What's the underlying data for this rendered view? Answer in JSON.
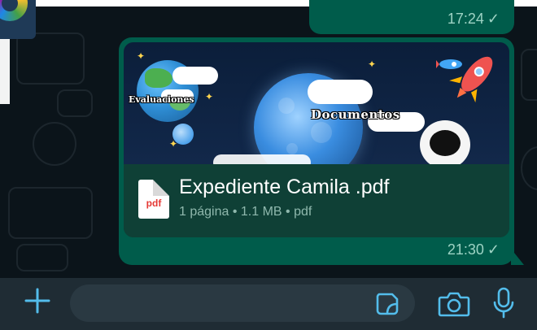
{
  "chat": {
    "previous_message": {
      "time": "17:24",
      "status": "sent"
    },
    "document_message": {
      "preview_labels": {
        "left": "Evaluaciones",
        "center": "Documentos"
      },
      "file_type_icon": "pdf",
      "file_name": "Expediente Camila .pdf",
      "file_meta": "1 página • 1.1 MB • pdf",
      "time": "21:30",
      "status": "sent"
    }
  },
  "input_bar": {
    "message_placeholder": "",
    "icons": {
      "attach": "plus-icon",
      "sticker": "sticker-icon",
      "camera": "camera-icon",
      "microphone": "microphone-icon"
    }
  },
  "colors": {
    "background": "#0b141a",
    "outgoing_bubble": "#005c4b",
    "input_bar": "#1f2c34",
    "input_field": "#2a3942",
    "accent": "#53bdeb"
  }
}
